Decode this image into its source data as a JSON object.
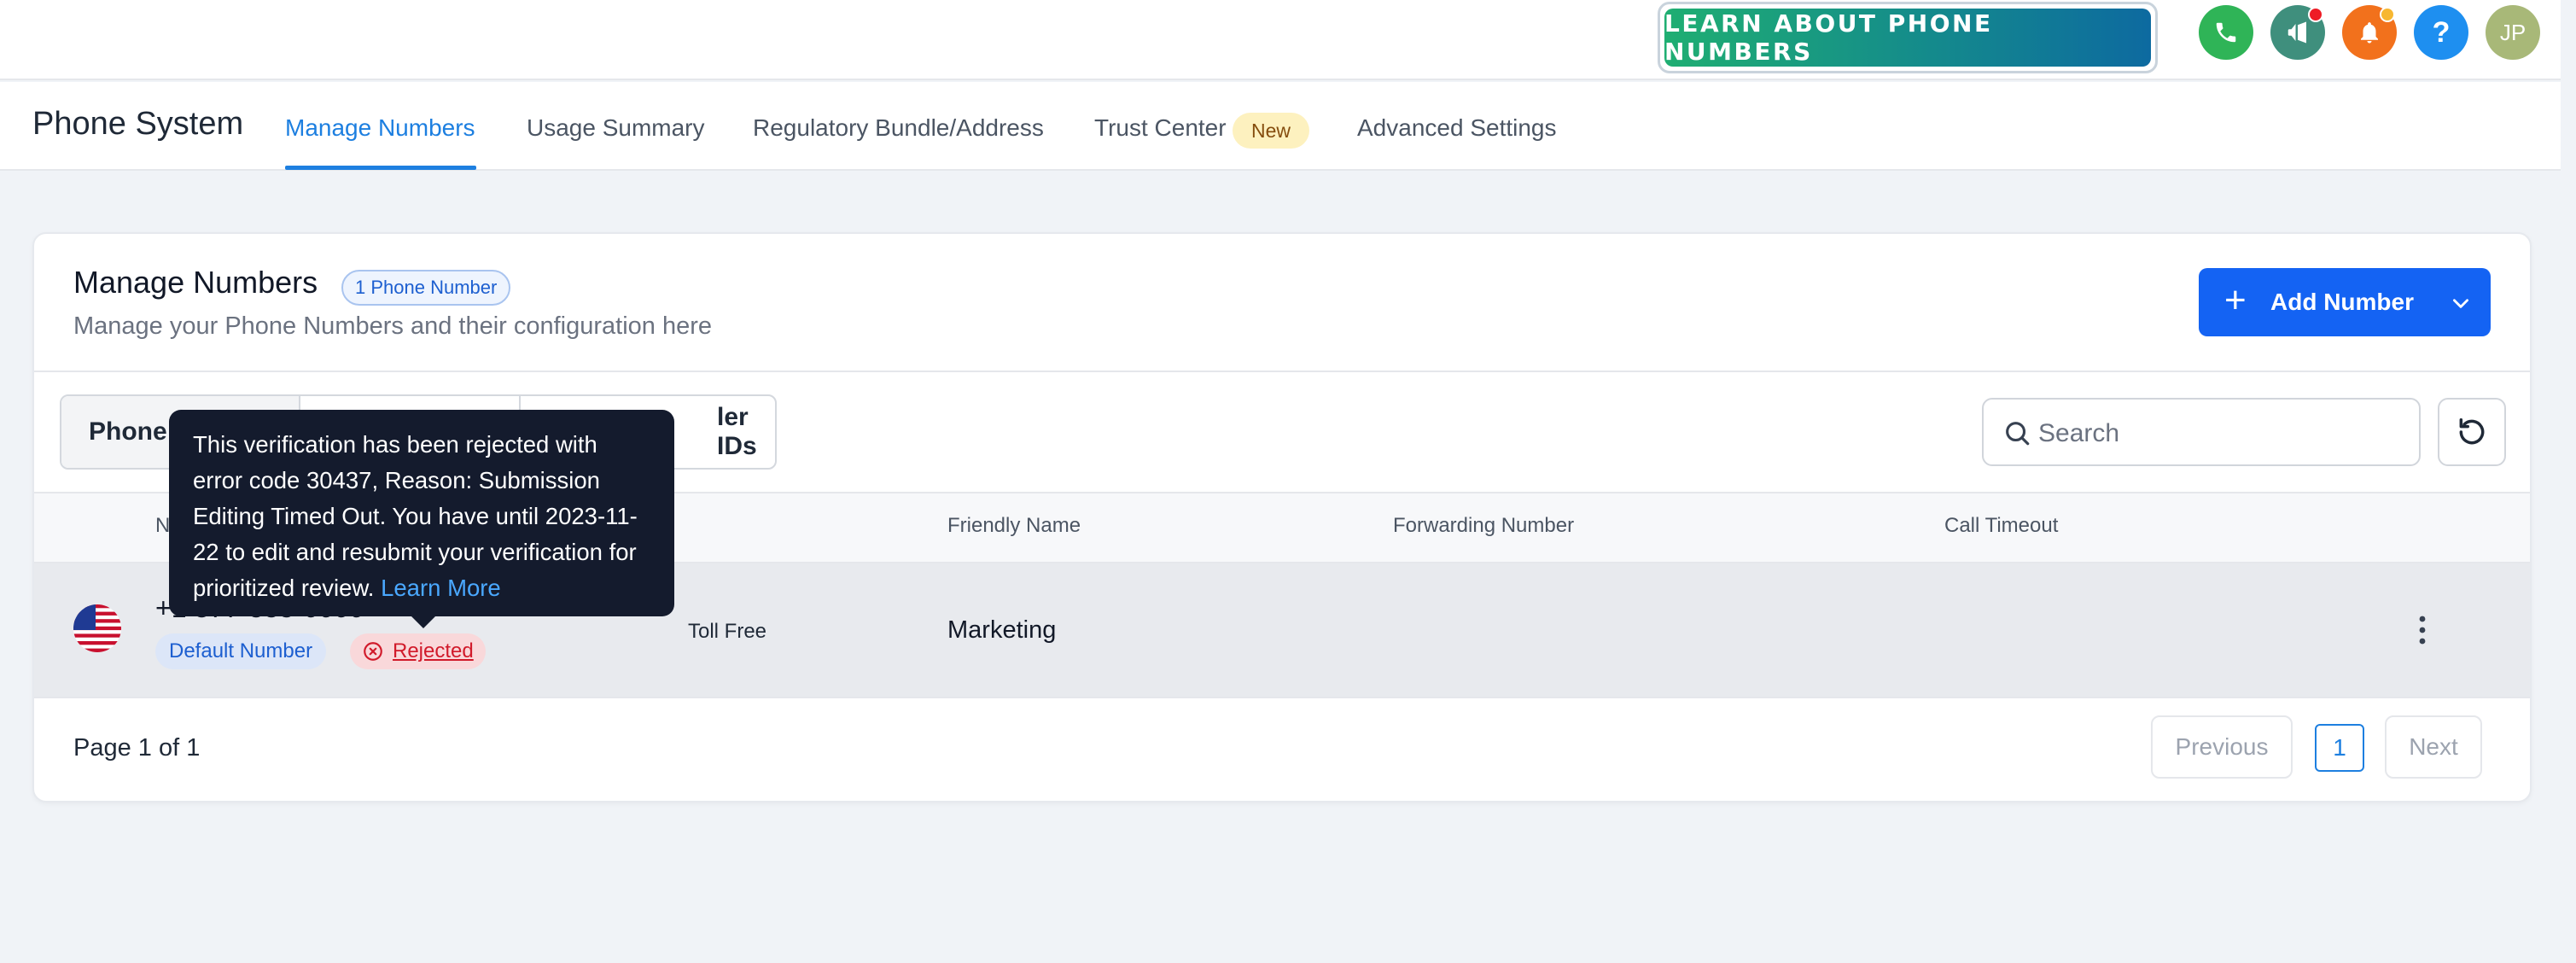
{
  "topbar": {
    "learn_button": "LEARN ABOUT PHONE NUMBERS",
    "avatar_initials": "JP",
    "icons": [
      "phone-icon",
      "megaphone-icon",
      "bell-icon",
      "help-icon"
    ],
    "colors": {
      "phone": "#2fb457",
      "megaphone": "#3f8f7d",
      "bell": "#f2711c",
      "help": "#1e8ff0",
      "avatar": "#a8b878",
      "notify_dot": "#ee1c25",
      "bell_dot": "#f7b731"
    }
  },
  "nav": {
    "app_title": "Phone System",
    "tabs": [
      {
        "label": "Manage Numbers",
        "active": true
      },
      {
        "label": "Usage Summary",
        "active": false
      },
      {
        "label": "Regulatory Bundle/Address",
        "active": false
      },
      {
        "label": "Trust Center",
        "active": false
      },
      {
        "label": "Advanced Settings",
        "active": false
      }
    ],
    "new_badge": "New"
  },
  "card": {
    "title": "Manage Numbers",
    "count_badge": "1 Phone Number",
    "subtitle": "Manage your Phone Numbers and their configuration here",
    "add_button": "Add Number",
    "segments": [
      "Phone",
      "",
      "ler IDs"
    ],
    "search_placeholder": "Search",
    "columns": [
      "N",
      "Friendly Name",
      "Forwarding Number",
      "Call Timeout"
    ],
    "rows": [
      {
        "phone": "+1 877-555-0000",
        "default_pill": "Default Number",
        "status_pill": "Rejected",
        "type": "Toll Free",
        "friendly_name": "Marketing",
        "forwarding_number": "",
        "call_timeout": ""
      }
    ],
    "pagination": {
      "info": "Page 1 of 1",
      "previous": "Previous",
      "current": "1",
      "next": "Next"
    }
  },
  "tooltip": {
    "text": "This verification has been rejected with error code 30437, Reason: Submission Editing Timed Out. You have until 2023-11-22 to edit and resubmit your verification for prioritized review. ",
    "link": "Learn More"
  }
}
